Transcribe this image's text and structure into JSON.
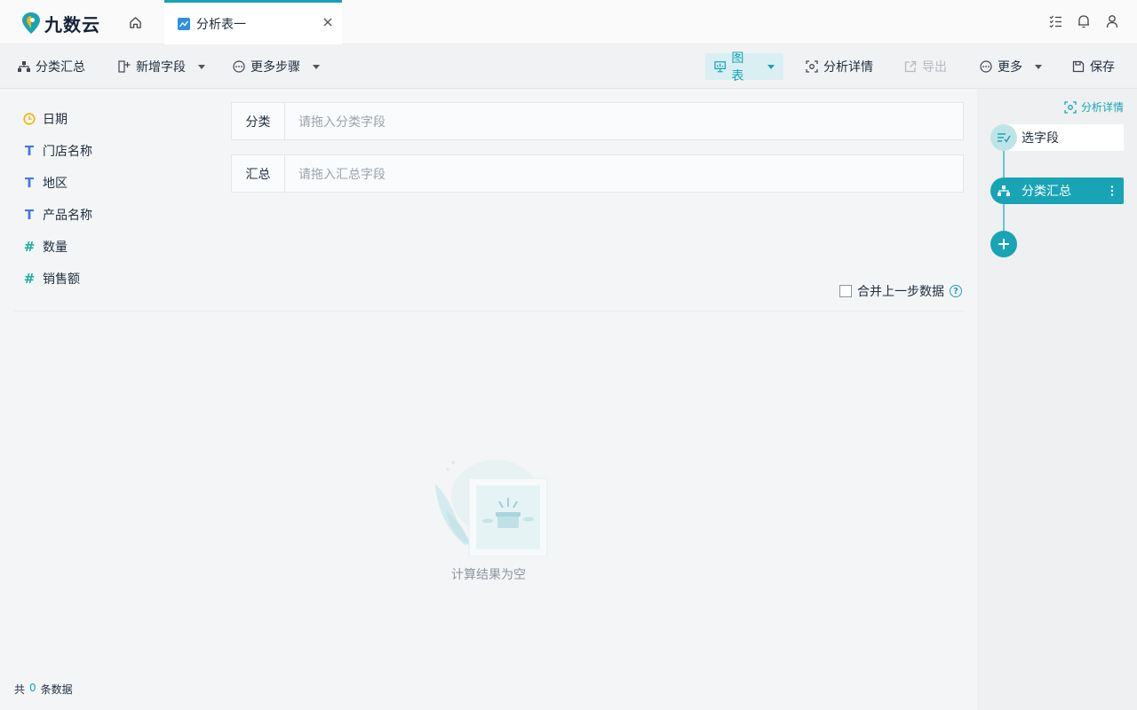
{
  "app": {
    "logo_text": "九数云",
    "tab_title": "分析表一"
  },
  "toolbar": {
    "group_summary": "分类汇总",
    "add_field": "新增字段",
    "more_steps": "更多步骤",
    "chart": "图表",
    "analysis_detail": "分析详情",
    "export": "导出",
    "more": "更多",
    "save": "保存"
  },
  "fields": [
    {
      "label": "日期",
      "type": "date"
    },
    {
      "label": "门店名称",
      "type": "text"
    },
    {
      "label": "地区",
      "type": "text"
    },
    {
      "label": "产品名称",
      "type": "text"
    },
    {
      "label": "数量",
      "type": "number"
    },
    {
      "label": "销售额",
      "type": "number"
    }
  ],
  "config": {
    "group_label": "分类",
    "group_placeholder": "请拖入分类字段",
    "summary_label": "汇总",
    "summary_placeholder": "请拖入汇总字段",
    "merge_label": "合并上一步数据"
  },
  "empty_state": {
    "text": "计算结果为空"
  },
  "footer": {
    "prefix": "共",
    "count": "0",
    "suffix": "条数据"
  },
  "side_panel": {
    "detail_link": "分析详情",
    "steps": [
      {
        "label": "选字段"
      },
      {
        "label": "分类汇总"
      }
    ]
  },
  "colors": {
    "accent": "#18a4b5",
    "date_icon": "#f5b400",
    "text_icon": "#3e7ed6",
    "number_icon": "#1bb09c"
  }
}
